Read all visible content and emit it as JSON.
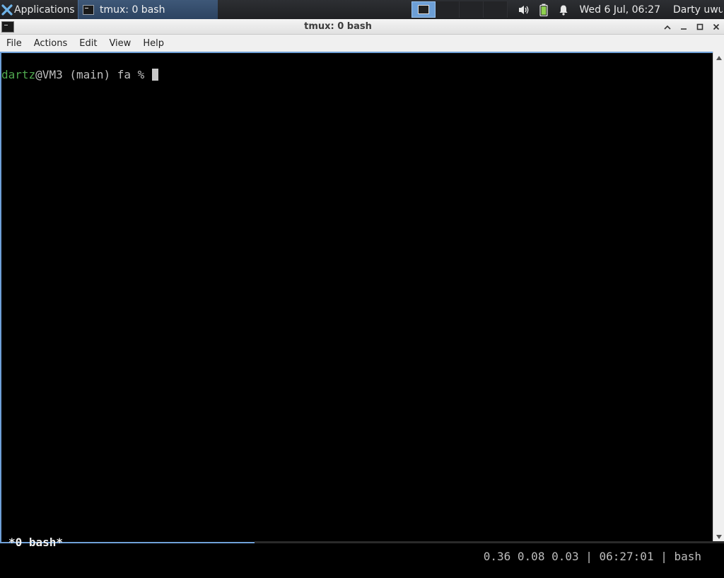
{
  "panel": {
    "apps_label": "Applications",
    "task_label": "tmux: 0 bash",
    "clock": "Wed  6 Jul, 06:27",
    "user": "Darty uwu"
  },
  "window": {
    "title": "tmux: 0 bash"
  },
  "menubar": {
    "items": [
      "File",
      "Actions",
      "Edit",
      "View",
      "Help"
    ]
  },
  "terminal": {
    "prompt_user": "dartz",
    "prompt_rest": "@VM3 (main) fa % "
  },
  "tmux": {
    "left": "*0 bash*",
    "right": "0.36 0.08 0.03 | 06:27:01 | bash"
  },
  "colors": {
    "prompt_user": "#4fa84f",
    "terminal_bg": "#000000",
    "active_border": "#6fa0d8"
  }
}
